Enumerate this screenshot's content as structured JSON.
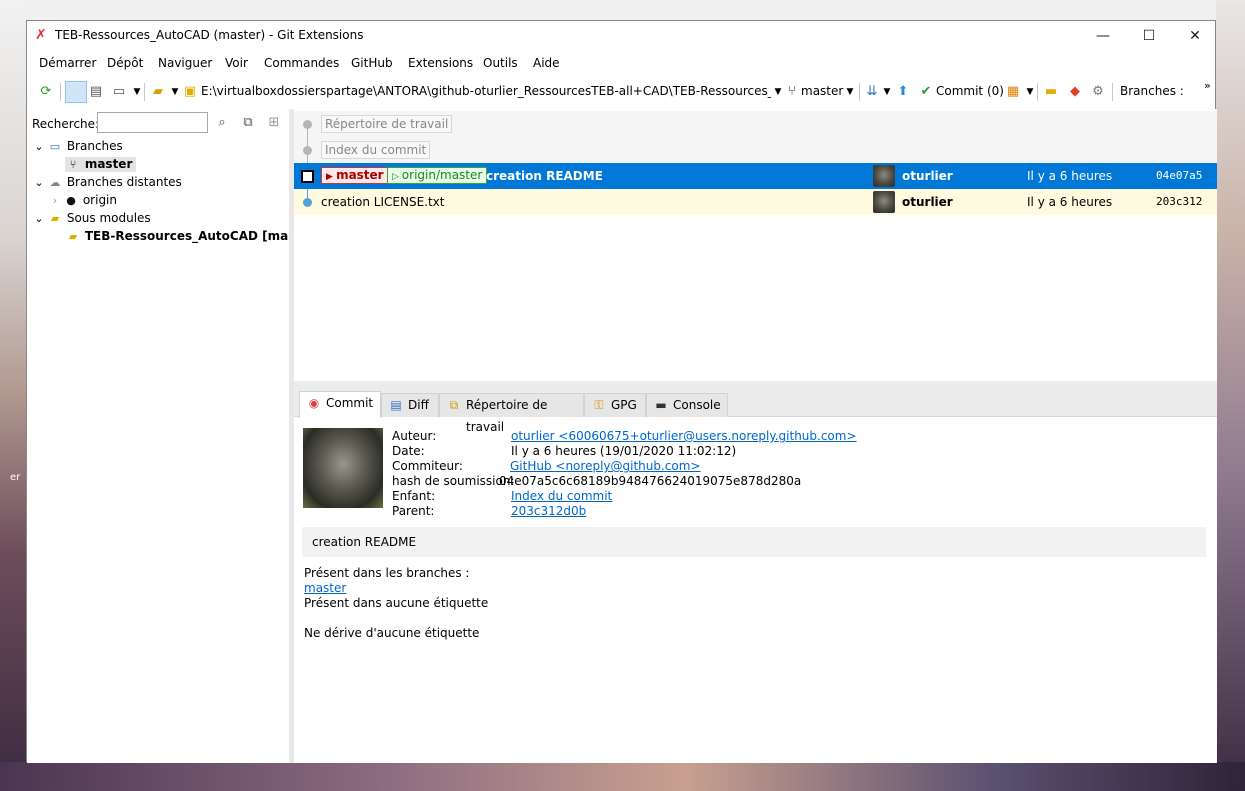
{
  "window": {
    "title": "TEB-Ressources_AutoCAD (master) - Git Extensions"
  },
  "menu": [
    "Démarrer",
    "Dépôt",
    "Naviguer",
    "Voir",
    "Commandes",
    "GitHub",
    "Extensions",
    "Outils",
    "Aide"
  ],
  "toolbar": {
    "path": "E:\\virtualboxdossierspartage\\ANTORA\\github-oturlier_RessourcesTEB-all+CAD\\TEB-Ressources_AutoCAD\\",
    "branch": "master",
    "commit_label": "Commit (0)",
    "branches_label": "Branches :",
    "overflow": "»"
  },
  "left": {
    "search_label": "Recherche:",
    "search_value": "",
    "tree": {
      "branches": "Branches",
      "master": "master",
      "remote_branches": "Branches distantes",
      "origin": "origin",
      "submodules": "Sous modules",
      "submodule_item": "TEB-Ressources_AutoCAD [master]"
    }
  },
  "graph": {
    "working_dir": "Répertoire de travail",
    "index": "Index du commit",
    "commits": [
      {
        "badges": [
          "master",
          "origin/master"
        ],
        "subject": "creation README",
        "author": "oturlier",
        "date": "Il y a 6 heures",
        "hash": "04e07a5"
      },
      {
        "badges": [],
        "subject": "creation LICENSE.txt",
        "author": "oturlier",
        "date": "Il y a 6 heures",
        "hash": "203c312"
      }
    ]
  },
  "tabs": [
    "Commit",
    "Diff",
    "Répertoire de travail",
    "GPG",
    "Console"
  ],
  "commit_info": {
    "labels": {
      "author": "Auteur:",
      "date": "Date:",
      "committer": "Commiteur:",
      "hash": "hash de soumission:",
      "child": "Enfant:",
      "parent": "Parent:"
    },
    "author": "oturlier <60060675+oturlier@users.noreply.github.com>",
    "date": "Il y a 6 heures (19/01/2020 11:02:12)",
    "committer": "GitHub <noreply@github.com>",
    "hash": "04e07a5c6c68189b948476624019075e878d280a",
    "child": "Index du commit",
    "parent": "203c312d0b",
    "message": "creation README",
    "branches_header": "Présent dans les branches :",
    "branches_value": "master",
    "no_tag": "Présent dans aucune étiquette",
    "no_derive": "Ne dérive d'aucune étiquette"
  },
  "edge_text": "er",
  "colors": {
    "selection": "#0078d7",
    "highlight_row": "#fffbe0",
    "link": "#0066cc"
  }
}
